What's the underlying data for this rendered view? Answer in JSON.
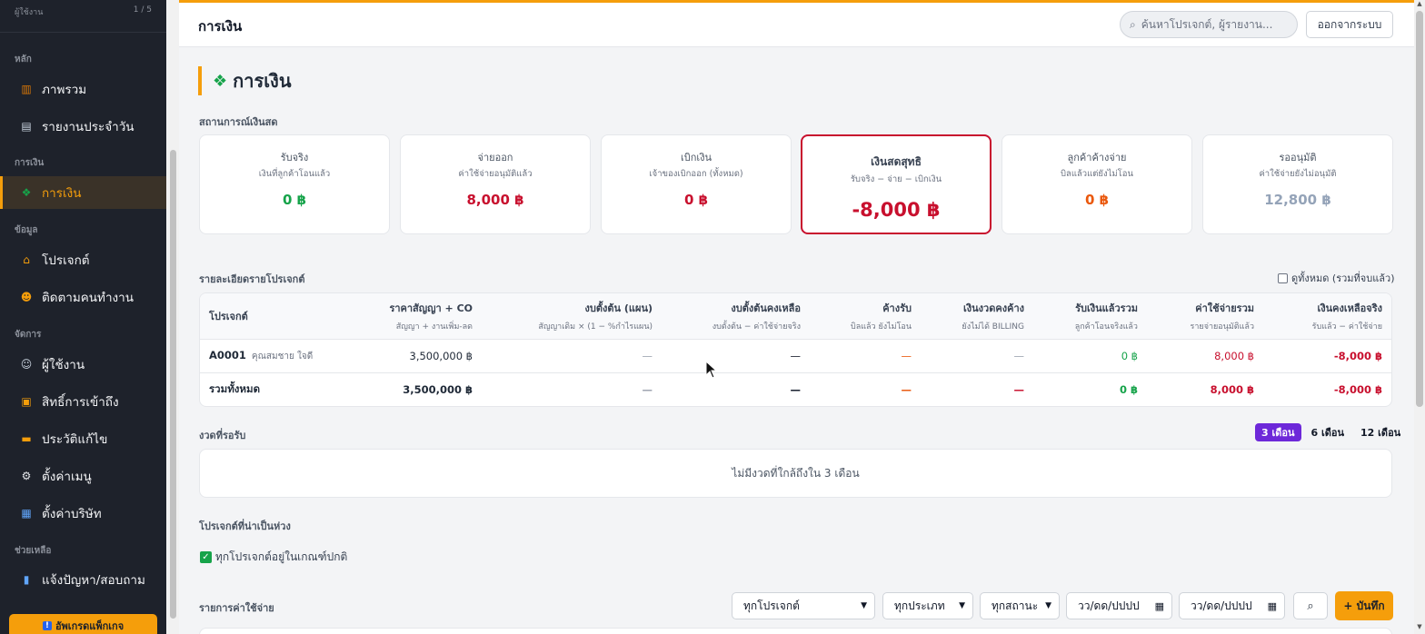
{
  "sidebar": {
    "top_label": "ผู้ใช้งาน",
    "top_count": "1 / 5",
    "sections": {
      "main": "หลัก",
      "finance": "การเงิน",
      "data": "ข้อมูล",
      "manage": "จัดการ",
      "help": "ช่วยเหลือ"
    },
    "items": [
      {
        "label": "ภาพรวม",
        "icon": "chart-icon"
      },
      {
        "label": "รายงานประจำวัน",
        "icon": "clipboard-icon"
      },
      {
        "label": "การเงิน",
        "icon": "money-icon"
      },
      {
        "label": "โปรเจกต์",
        "icon": "house-icon"
      },
      {
        "label": "ติดตามคนทำงาน",
        "icon": "worker-icon"
      },
      {
        "label": "ผู้ใช้งาน",
        "icon": "users-icon"
      },
      {
        "label": "สิทธิ์การเข้าถึง",
        "icon": "lock-icon"
      },
      {
        "label": "ประวัติแก้ไข",
        "icon": "folder-icon"
      },
      {
        "label": "ตั้งค่าเมนู",
        "icon": "gear-icon"
      },
      {
        "label": "ตั้งค่าบริษัท",
        "icon": "building-icon"
      },
      {
        "label": "แจ้งปัญหา/สอบถาม",
        "icon": "book-icon"
      }
    ],
    "upgrade": "อัพเกรดแพ็กเกจ"
  },
  "topbar": {
    "title": "การเงิน",
    "search_placeholder": "ค้นหาโปรเจกต์, ผู้รายงาน...",
    "logout": "ออกจากระบบ"
  },
  "page": {
    "heading": "การเงิน",
    "cash_section": "สถานการณ์เงินสด"
  },
  "cards": [
    {
      "title": "รับจริง",
      "subtitle": "เงินที่ลูกค้าโอนแล้ว",
      "value": "0 ฿"
    },
    {
      "title": "จ่ายออก",
      "subtitle": "ค่าใช้จ่ายอนุมัติแล้ว",
      "value": "8,000 ฿"
    },
    {
      "title": "เบิกเงิน",
      "subtitle": "เจ้าของเบิกออก (ทั้งหมด)",
      "value": "0 ฿"
    },
    {
      "title": "เงินสดสุทธิ",
      "subtitle": "รับจริง − จ่าย − เบิกเงิน",
      "value": "-8,000 ฿"
    },
    {
      "title": "ลูกค้าค้างจ่าย",
      "subtitle": "บิลแล้วแต่ยังไม่โอน",
      "value": "0 ฿"
    },
    {
      "title": "รออนุมัติ",
      "subtitle": "ค่าใช้จ่ายยังไม่อนุมัติ",
      "value": "12,800 ฿"
    }
  ],
  "colors": {
    "accent": "#f59e0b",
    "green": "#16a34a",
    "red": "#c8102e",
    "orange": "#ea580c",
    "gray": "#94a3b8",
    "purple": "#6d28d9"
  },
  "project_table": {
    "section": "รายละเอียดรายโปรเจกต์",
    "show_all": "ดูทั้งหมด (รวมที่จบแล้ว)",
    "headers": [
      {
        "label": "โปรเจกต์",
        "sub": ""
      },
      {
        "label": "ราคาสัญญา + CO",
        "sub": "สัญญา + งานเพิ่ม-ลด"
      },
      {
        "label": "งบตั้งต้น (แผน)",
        "sub": "สัญญาเดิม × (1 − %กำไรแผน)"
      },
      {
        "label": "งบตั้งต้นคงเหลือ",
        "sub": "งบตั้งต้น − ค่าใช้จ่ายจริง"
      },
      {
        "label": "ค้างรับ",
        "sub": "บิลแล้ว ยังไม่โอน"
      },
      {
        "label": "เงินงวดคงค้าง",
        "sub": "ยังไม่ได้ BILLING"
      },
      {
        "label": "รับเงินแล้วรวม",
        "sub": "ลูกค้าโอนจริงแล้ว"
      },
      {
        "label": "ค่าใช้จ่ายรวม",
        "sub": "รายจ่ายอนุมัติแล้ว"
      },
      {
        "label": "เงินคงเหลือจริง",
        "sub": "รับแล้ว − ค่าใช้จ่าย"
      }
    ],
    "rows": [
      {
        "code": "A0001",
        "name": "คุณสมชาย ใจดี",
        "contract": "3,500,000 ฿",
        "budget": "—",
        "budget_left": "—",
        "receivable": "—",
        "pending": "—",
        "received": "0 ฿",
        "expense": "8,000 ฿",
        "balance": "-8,000 ฿"
      },
      {
        "code": "รวมทั้งหมด",
        "name": "",
        "contract": "3,500,000 ฿",
        "budget": "—",
        "budget_left": "—",
        "receivable": "—",
        "pending": "—",
        "received": "0 ฿",
        "expense": "8,000 ฿",
        "balance": "-8,000 ฿"
      }
    ]
  },
  "installments": {
    "section": "งวดที่รอรับ",
    "ranges": [
      "3 เดือน",
      "6 เดือน",
      "12 เดือน"
    ],
    "selected": "3 เดือน",
    "empty": "ไม่มีงวดที่ใกล้ถึงใน 3 เดือน"
  },
  "watch": {
    "section": "โปรเจกต์ที่น่าเป็นห่วง",
    "ok_text": "ทุกโปรเจกต์อยู่ในเกณฑ์ปกติ"
  },
  "expenses": {
    "section": "รายการค่าใช้จ่าย",
    "project_filter": "ทุกโปรเจกต์",
    "type_filter": "ทุกประเภท",
    "status_filter": "ทุกสถานะ",
    "date_from": "วว/ดด/ปปปป",
    "date_to": "วว/ดด/ปปปป",
    "add_button": "+ บันทึก"
  }
}
